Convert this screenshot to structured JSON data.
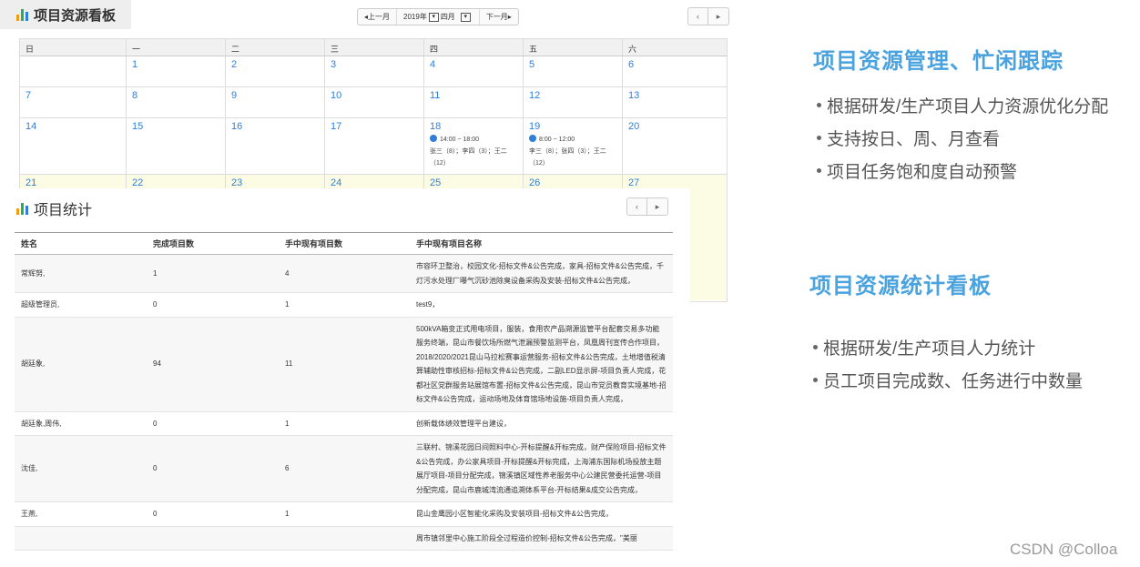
{
  "calendar": {
    "title": "项目资源看板",
    "nav": {
      "prev": "◂上一月",
      "year": "2019年",
      "month": "四月",
      "next": "下一月▸"
    },
    "pager": {
      "prev": "‹",
      "next": "▸"
    },
    "weekdays": [
      "日",
      "一",
      "二",
      "三",
      "四",
      "五",
      "六"
    ],
    "weeks": [
      [
        "",
        "1",
        "2",
        "3",
        "4",
        "5",
        "6"
      ],
      [
        "7",
        "8",
        "9",
        "10",
        "11",
        "12",
        "13"
      ],
      [
        "14",
        "15",
        "16",
        "17",
        "18",
        "19",
        "20"
      ],
      [
        "21",
        "22",
        "23",
        "24",
        "25",
        "26",
        "27"
      ]
    ],
    "events": {
      "thu18": {
        "time": "14:00 ~ 18:00",
        "people": "张三（8）；李四（3）；王二（12）"
      },
      "fri19": {
        "time": "8:00 ~ 12:00",
        "people": "李三（8）；张四（3）；王二（12）"
      }
    }
  },
  "stats": {
    "title": "项目统计",
    "columns": [
      "姓名",
      "完成项目数",
      "手中现有项目数",
      "手中现有项目名称"
    ],
    "rows": [
      {
        "name": "常辉努,",
        "done": "1",
        "current": "4",
        "projects": "市容环卫整治，校园文化-招标文件&公告完成，家具-招标文件&公告完成，千灯污水处理厂曝气沉砂池除臭设备采购及安装-招标文件&公告完成，"
      },
      {
        "name": "超级管理员,",
        "done": "0",
        "current": "1",
        "projects": "test9，"
      },
      {
        "name": "胡廷象,",
        "done": "94",
        "current": "11",
        "projects": "500kVA箱变正式用电项目，服装，食用农产品溯源监管平台配套交易多功能服务终端，昆山市餐饮场所燃气泄漏预警监测平台，凤凰周刊宣传合作项目，2018/2020/2021昆山马拉松赛事运营服务-招标文件&公告完成，土地增值税清算辅助性审核招标-招标文件&公告完成，二副LED显示屏-项目负责人完成，花都社区党群服务站展馆布置-招标文件&公告完成，昆山市党员教育实境基地-招标文件&公告完成，运动场地及体育馆场地设施-项目负责人完成，"
      },
      {
        "name": "胡廷象,周伟,",
        "done": "0",
        "current": "1",
        "projects": "创新载体绩效管理平台建设，"
      },
      {
        "name": "沈佳,",
        "done": "0",
        "current": "6",
        "projects": "三联村、锦溪花园日间照料中心-开标提醒&开标完成，财产保险项目-招标文件&公告完成，办公家具项目-开标提醒&开标完成，上海浦东国际机场投放主题展厅项目-项目分配完成，锦溪镇区域性养老服务中心公建民营委托运营-项目分配完成，昆山市鹿城湾流通追溯体系平台-开标结果&成交公告完成，"
      },
      {
        "name": "王燕,",
        "done": "0",
        "current": "1",
        "projects": "昆山金鹰园小区智能化采购及安装项目-招标文件&公告完成，"
      },
      {
        "name": "",
        "done": "",
        "current": "",
        "projects": "周市镇邻里中心施工阶段全过程造价控制-招标文件&公告完成，\"美丽"
      }
    ]
  },
  "right": {
    "heading1": "项目资源管理、忙闲跟踪",
    "bullets1": [
      "根据研发/生产项目人力资源优化分配",
      "支持按日、周、月查看",
      "项目任务饱和度自动预警"
    ],
    "heading2": "项目资源统计看板",
    "bullets2": [
      "根据研发/生产项目人力统计",
      "员工项目完成数、任务进行中数量"
    ]
  },
  "watermark": "CSDN @Colloa"
}
